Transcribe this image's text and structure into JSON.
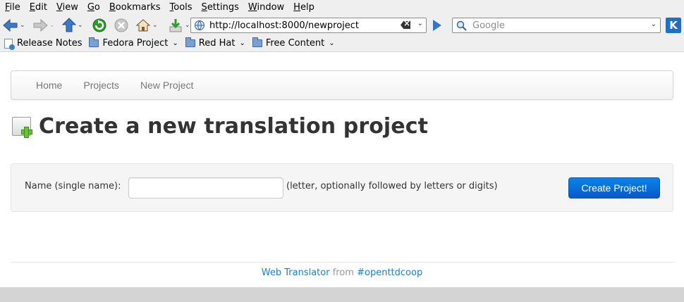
{
  "browser": {
    "menu": [
      {
        "acc": "F",
        "rest": "ile"
      },
      {
        "acc": "E",
        "rest": "dit"
      },
      {
        "acc": "V",
        "rest": "iew"
      },
      {
        "acc": "G",
        "rest": "o"
      },
      {
        "acc": "B",
        "rest": "ookmarks"
      },
      {
        "acc": "T",
        "rest": "ools"
      },
      {
        "acc": "S",
        "rest": "ettings"
      },
      {
        "acc": "W",
        "rest": "indow"
      },
      {
        "acc": "H",
        "rest": "elp"
      }
    ],
    "url": "http://localhost:8000/newproject",
    "search_placeholder": "Google",
    "bookmarks": [
      {
        "label": "Release Notes",
        "type": "page",
        "has_menu": false
      },
      {
        "label": "Fedora Project",
        "type": "folder",
        "has_menu": true
      },
      {
        "label": "Red Hat",
        "type": "folder",
        "has_menu": true
      },
      {
        "label": "Free Content",
        "type": "folder",
        "has_menu": true
      }
    ],
    "icons": {
      "back": "back-arrow-icon",
      "forward": "forward-arrow-icon",
      "up": "up-arrow-icon",
      "reload": "reload-icon",
      "stop": "stop-icon",
      "home": "home-icon",
      "download": "download-icon",
      "go": "go-icon",
      "kde": "kde-icon"
    },
    "accent": "#3476c6"
  },
  "page": {
    "nav": [
      "Home",
      "Projects",
      "New Project"
    ],
    "title": "Create a new translation project",
    "form": {
      "label": "Name (single name):",
      "input_value": "",
      "hint": "(letter, optionally followed by letters or digits)",
      "submit": "Create Project!"
    },
    "footer": {
      "link1": "Web Translator",
      "from": "from",
      "link2": "#openttdcoop"
    },
    "colors": {
      "button": "#0a6fd8",
      "link": "#1a83c5",
      "heading": "#333333"
    }
  }
}
